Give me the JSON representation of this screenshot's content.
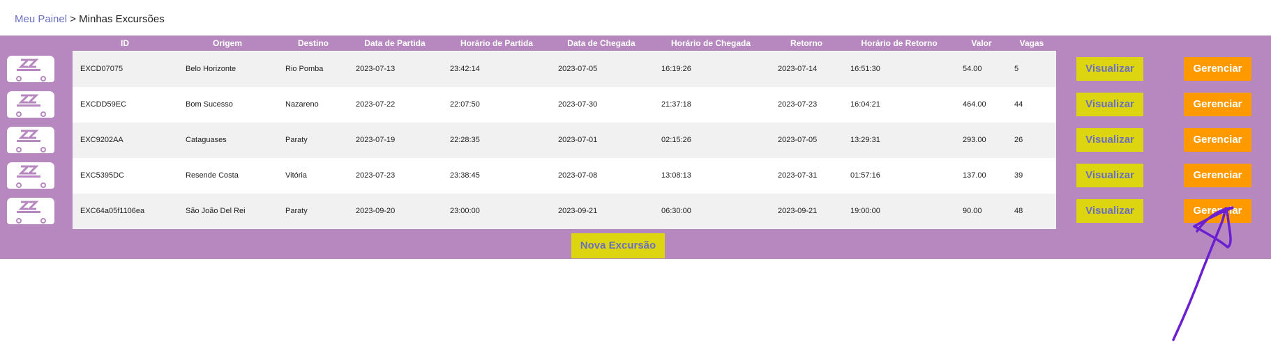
{
  "breadcrumb": {
    "link": "Meu Painel",
    "separator": ">",
    "current": "Minhas Excursões"
  },
  "table": {
    "headers": {
      "id": "ID",
      "origem": "Origem",
      "destino": "Destino",
      "data_partida": "Data de Partida",
      "horario_partida": "Horário de Partida",
      "data_chegada": "Data de Chegada",
      "horario_chegada": "Horário de Chegada",
      "retorno": "Retorno",
      "horario_retorno": "Horário de Retorno",
      "valor": "Valor",
      "vagas": "Vagas"
    },
    "rows": [
      {
        "id": "EXCD07075",
        "origem": "Belo Horizonte",
        "destino": "Rio Pomba",
        "data_partida": "2023-07-13",
        "horario_partida": "23:42:14",
        "data_chegada": "2023-07-05",
        "horario_chegada": "16:19:26",
        "retorno": "2023-07-14",
        "horario_retorno": "16:51:30",
        "valor": "54.00",
        "vagas": "5"
      },
      {
        "id": "EXCDD59EC",
        "origem": "Bom Sucesso",
        "destino": "Nazareno",
        "data_partida": "2023-07-22",
        "horario_partida": "22:07:50",
        "data_chegada": "2023-07-30",
        "horario_chegada": "21:37:18",
        "retorno": "2023-07-23",
        "horario_retorno": "16:04:21",
        "valor": "464.00",
        "vagas": "44"
      },
      {
        "id": "EXC9202AA",
        "origem": "Cataguases",
        "destino": "Paraty",
        "data_partida": "2023-07-19",
        "horario_partida": "22:28:35",
        "data_chegada": "2023-07-01",
        "horario_chegada": "02:15:26",
        "retorno": "2023-07-05",
        "horario_retorno": "13:29:31",
        "valor": "293.00",
        "vagas": "26"
      },
      {
        "id": "EXC5395DC",
        "origem": "Resende Costa",
        "destino": "Vitória",
        "data_partida": "2023-07-23",
        "horario_partida": "23:38:45",
        "data_chegada": "2023-07-08",
        "horario_chegada": "13:08:13",
        "retorno": "2023-07-31",
        "horario_retorno": "01:57:16",
        "valor": "137.00",
        "vagas": "39"
      },
      {
        "id": "EXC64a05f1106ea",
        "origem": "São João Del Rei",
        "destino": "Paraty",
        "data_partida": "2023-09-20",
        "horario_partida": "23:00:00",
        "data_chegada": "2023-09-21",
        "horario_chegada": "06:30:00",
        "retorno": "2023-09-21",
        "horario_retorno": "19:00:00",
        "valor": "90.00",
        "vagas": "48"
      }
    ]
  },
  "actions": {
    "view_label": "Visualizar",
    "manage_label": "Gerenciar",
    "new_label": "Nova Excursão"
  },
  "logo": {
    "icon": "bus-logo-icon"
  },
  "colors": {
    "band": "#b788bf",
    "view_button": "#dcd50f",
    "manage_button": "#ff9900",
    "link": "#6a6fc0",
    "scribble": "#6a1fd0"
  }
}
